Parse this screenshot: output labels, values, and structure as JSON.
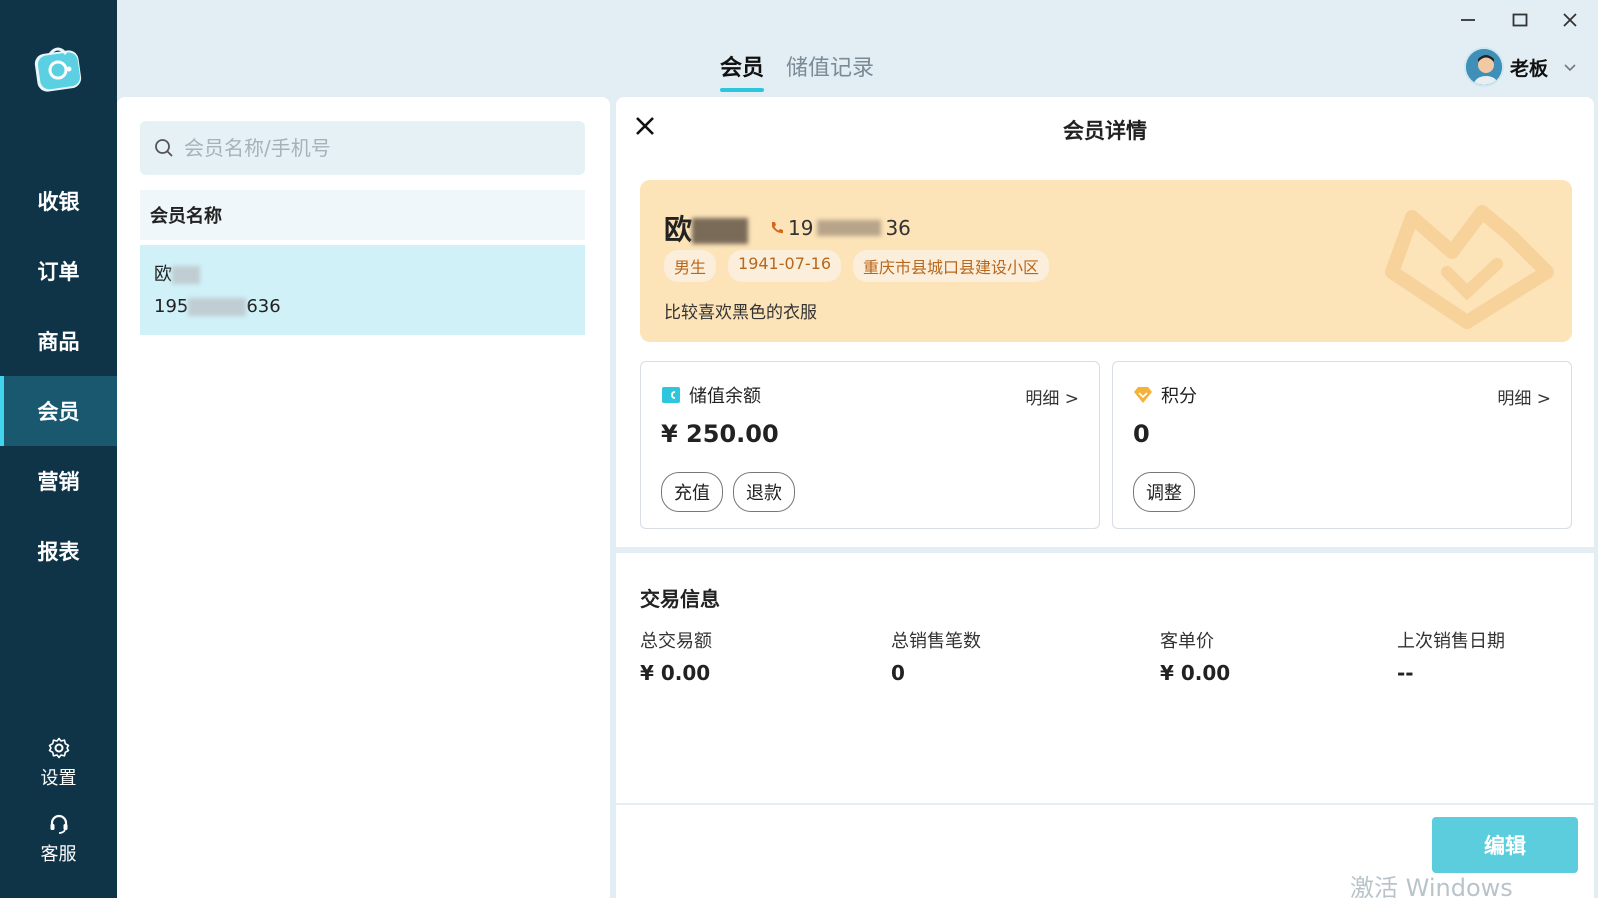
{
  "sidebar": {
    "logo_icon": "app-logo-icon",
    "nav": [
      {
        "label": "收银"
      },
      {
        "label": "订单"
      },
      {
        "label": "商品"
      },
      {
        "label": "会员"
      },
      {
        "label": "营销"
      },
      {
        "label": "报表"
      }
    ],
    "active": "会员",
    "settings_label": "设置",
    "support_label": "客服"
  },
  "header": {
    "tabs": [
      {
        "label": "会员"
      },
      {
        "label": "储值记录"
      }
    ],
    "user_name": "老板"
  },
  "member_list": {
    "search_placeholder": "会员名称/手机号",
    "column_header": "会员名称",
    "rows": [
      {
        "name": "欧",
        "phone_prefix": "195",
        "phone_suffix": "636"
      }
    ]
  },
  "detail": {
    "title": "会员详情",
    "name": "欧",
    "phone_prefix": "19",
    "phone_suffix": "36",
    "tags": [
      "男生",
      "1941-07-16",
      "重庆市县城口县建设小区"
    ],
    "note": "比较喜欢黑色的衣服",
    "balance": {
      "label": "储值余额",
      "link": "明细 >",
      "value": "¥ 250.00",
      "buttons": [
        "充值",
        "退款"
      ]
    },
    "points": {
      "label": "积分",
      "link": "明细 >",
      "value": "0",
      "buttons": [
        "调整"
      ]
    },
    "trade": {
      "title": "交易信息",
      "stats": [
        {
          "label": "总交易额",
          "value": "¥ 0.00"
        },
        {
          "label": "总销售笔数",
          "value": "0"
        },
        {
          "label": "客单价",
          "value": "¥ 0.00"
        },
        {
          "label": "上次销售日期",
          "value": "--"
        }
      ]
    },
    "edit_label": "编辑"
  },
  "watermark": "激活 Windows",
  "colors": {
    "sidebar_bg": "#0f3447",
    "accent": "#2ec6dc",
    "card_bg": "#fce3b8",
    "tag_text": "#b8681e"
  }
}
